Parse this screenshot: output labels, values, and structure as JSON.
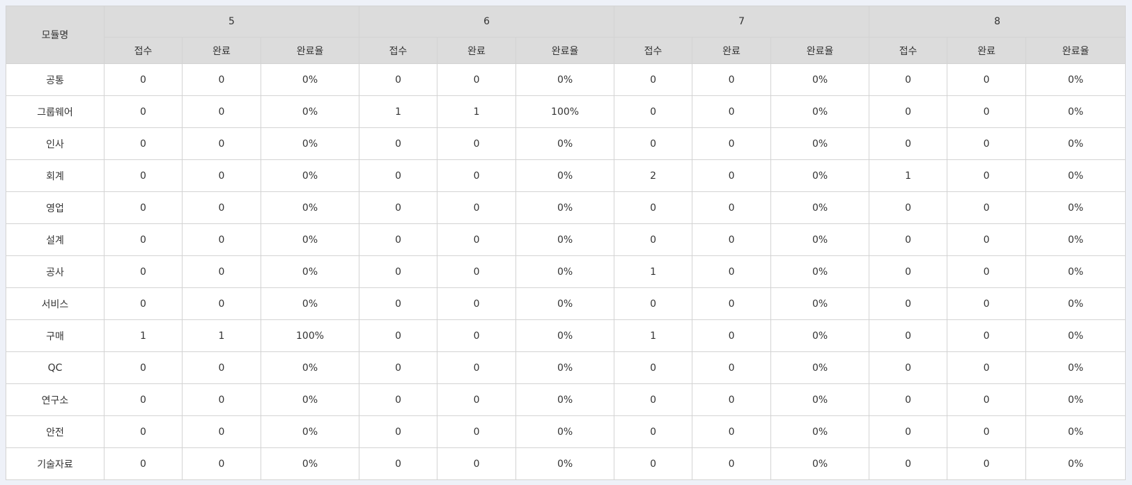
{
  "table": {
    "module_header": "모듈명",
    "months": [
      "5",
      "6",
      "7",
      "8"
    ],
    "sub_headers": [
      "접수",
      "완료",
      "완료율"
    ],
    "rows": [
      {
        "module": "공통",
        "values": [
          "0",
          "0",
          "0%",
          "0",
          "0",
          "0%",
          "0",
          "0",
          "0%",
          "0",
          "0",
          "0%"
        ]
      },
      {
        "module": "그룹웨어",
        "values": [
          "0",
          "0",
          "0%",
          "1",
          "1",
          "100%",
          "0",
          "0",
          "0%",
          "0",
          "0",
          "0%"
        ]
      },
      {
        "module": "인사",
        "values": [
          "0",
          "0",
          "0%",
          "0",
          "0",
          "0%",
          "0",
          "0",
          "0%",
          "0",
          "0",
          "0%"
        ]
      },
      {
        "module": "회계",
        "values": [
          "0",
          "0",
          "0%",
          "0",
          "0",
          "0%",
          "2",
          "0",
          "0%",
          "1",
          "0",
          "0%"
        ]
      },
      {
        "module": "영업",
        "values": [
          "0",
          "0",
          "0%",
          "0",
          "0",
          "0%",
          "0",
          "0",
          "0%",
          "0",
          "0",
          "0%"
        ]
      },
      {
        "module": "설계",
        "values": [
          "0",
          "0",
          "0%",
          "0",
          "0",
          "0%",
          "0",
          "0",
          "0%",
          "0",
          "0",
          "0%"
        ]
      },
      {
        "module": "공사",
        "values": [
          "0",
          "0",
          "0%",
          "0",
          "0",
          "0%",
          "1",
          "0",
          "0%",
          "0",
          "0",
          "0%"
        ]
      },
      {
        "module": "서비스",
        "values": [
          "0",
          "0",
          "0%",
          "0",
          "0",
          "0%",
          "0",
          "0",
          "0%",
          "0",
          "0",
          "0%"
        ]
      },
      {
        "module": "구매",
        "values": [
          "1",
          "1",
          "100%",
          "0",
          "0",
          "0%",
          "1",
          "0",
          "0%",
          "0",
          "0",
          "0%"
        ]
      },
      {
        "module": "QC",
        "values": [
          "0",
          "0",
          "0%",
          "0",
          "0",
          "0%",
          "0",
          "0",
          "0%",
          "0",
          "0",
          "0%"
        ]
      },
      {
        "module": "연구소",
        "values": [
          "0",
          "0",
          "0%",
          "0",
          "0",
          "0%",
          "0",
          "0",
          "0%",
          "0",
          "0",
          "0%"
        ]
      },
      {
        "module": "안전",
        "values": [
          "0",
          "0",
          "0%",
          "0",
          "0",
          "0%",
          "0",
          "0",
          "0%",
          "0",
          "0",
          "0%"
        ]
      },
      {
        "module": "기술자료",
        "values": [
          "0",
          "0",
          "0%",
          "0",
          "0",
          "0%",
          "0",
          "0",
          "0%",
          "0",
          "0",
          "0%"
        ]
      }
    ]
  }
}
